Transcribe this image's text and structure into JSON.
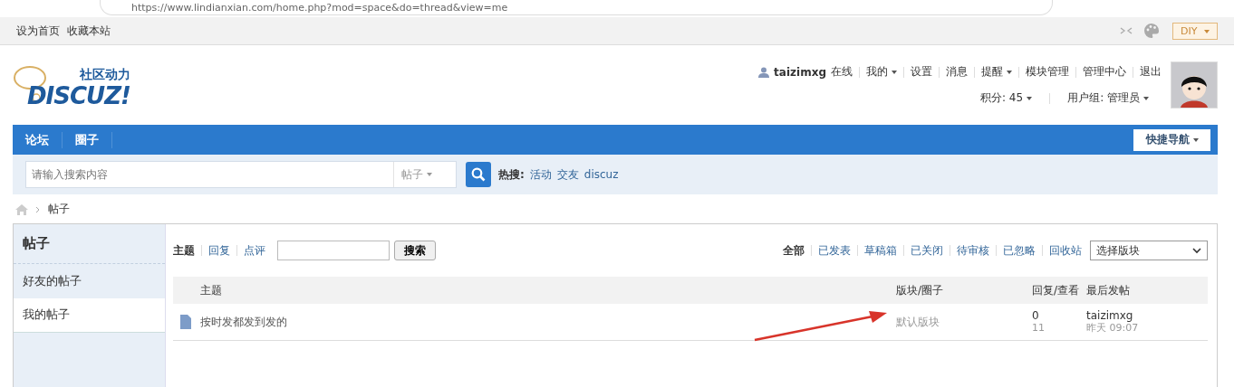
{
  "browser": {
    "url": "https://www.lindianxian.com/home.php?mod=space&do=thread&view=me"
  },
  "topbar": {
    "links": [
      "设为首页",
      "收藏本站"
    ],
    "diy": "DIY"
  },
  "logo": {
    "tagline": "社区动力",
    "name": "DISCUZ!"
  },
  "user": {
    "name": "taizimxg",
    "status": "在线",
    "links": [
      {
        "label": "我的",
        "dropdown": true
      },
      {
        "label": "设置",
        "dropdown": false
      },
      {
        "label": "消息",
        "dropdown": false
      },
      {
        "label": "提醒",
        "dropdown": true
      },
      {
        "label": "模块管理",
        "dropdown": false
      },
      {
        "label": "管理中心",
        "dropdown": false
      },
      {
        "label": "退出",
        "dropdown": false
      }
    ],
    "points": "积分: 45",
    "group": "用户组: 管理员"
  },
  "nav": {
    "items": [
      "论坛",
      "圈子"
    ],
    "quick": "快捷导航"
  },
  "search": {
    "placeholder": "请输入搜索内容",
    "type": "帖子",
    "hot_label": "热搜:",
    "hot": [
      "活动",
      "交友",
      "discuz"
    ]
  },
  "breadcrumb": "帖子",
  "sidebar": {
    "title": "帖子",
    "items": [
      {
        "label": "好友的帖子",
        "selected": false
      },
      {
        "label": "我的帖子",
        "selected": true
      }
    ]
  },
  "filter_tabs": [
    {
      "label": "主题",
      "selected": true
    },
    {
      "label": "回复",
      "selected": false
    },
    {
      "label": "点评",
      "selected": false
    }
  ],
  "search_button": "搜索",
  "status_tabs": [
    {
      "label": "全部",
      "selected": true
    },
    {
      "label": "已发表",
      "selected": false
    },
    {
      "label": "草稿箱",
      "selected": false
    },
    {
      "label": "已关闭",
      "selected": false
    },
    {
      "label": "待审核",
      "selected": false
    },
    {
      "label": "已忽略",
      "selected": false
    },
    {
      "label": "回收站",
      "selected": false
    }
  ],
  "forum_select": "选择版块",
  "table": {
    "columns": [
      "主题",
      "版块/圈子",
      "回复/查看",
      "最后发帖"
    ],
    "rows": [
      {
        "title": "按时发都发到发的",
        "forum": "默认版块",
        "replies": "0",
        "views": "11",
        "last_user": "taizimxg",
        "last_time": "昨天 09:07"
      }
    ]
  }
}
